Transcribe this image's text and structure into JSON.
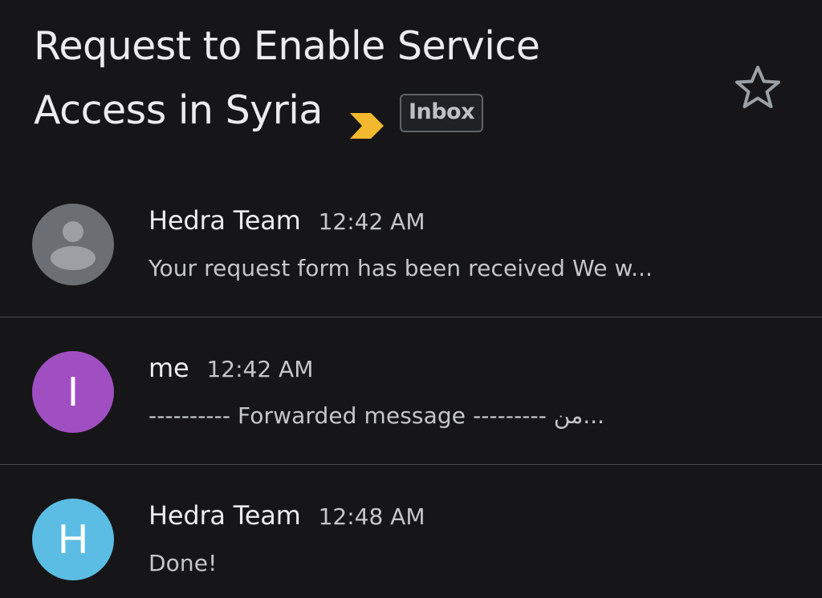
{
  "subject": {
    "line1": "Request to Enable Service",
    "line2": "Access in Syria",
    "label": "Inbox"
  },
  "icons": {
    "importance": "importance-marker-icon",
    "star": "star-outline-icon",
    "default_avatar": "person-silhouette-icon"
  },
  "colors": {
    "background": "#161618",
    "importance": "#f2b92f",
    "avatar_default": "#6b6e72",
    "avatar_me": "#a04fc2",
    "avatar_hedra": "#5bbde4"
  },
  "messages": [
    {
      "sender": "Hedra Team",
      "time": "12:42 AM",
      "snippet": "Your request form has been received We w...",
      "avatar_letter": ""
    },
    {
      "sender": "me",
      "time": "12:42 AM",
      "snippet": "---------- Forwarded message --------- من...",
      "avatar_letter": "I"
    },
    {
      "sender": "Hedra Team",
      "time": "12:48 AM",
      "snippet": "Done!",
      "avatar_letter": "H"
    }
  ]
}
